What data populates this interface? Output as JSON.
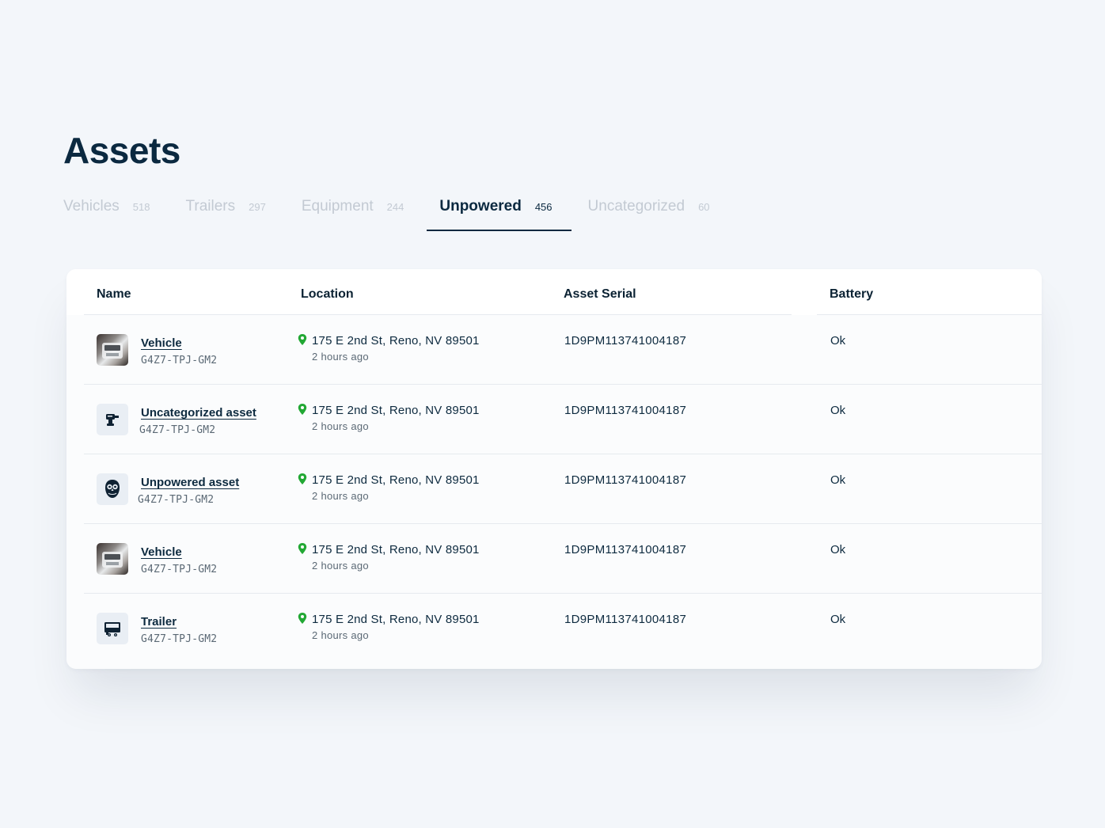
{
  "page": {
    "title": "Assets"
  },
  "tabs": [
    {
      "label": "Vehicles",
      "count": "518",
      "active": false
    },
    {
      "label": "Trailers",
      "count": "297",
      "active": false
    },
    {
      "label": "Equipment",
      "count": "244",
      "active": false
    },
    {
      "label": "Unpowered",
      "count": "456",
      "active": true
    },
    {
      "label": "Uncategorized",
      "count": "60",
      "active": false
    }
  ],
  "table": {
    "columns": [
      "Name",
      "Location",
      "Asset Serial",
      "Battery"
    ],
    "rows": [
      {
        "icon": "truck-photo",
        "name": "Vehicle",
        "id": "G4Z7-TPJ-GM2",
        "address": "175 E 2nd St, Reno, NV 89501",
        "updated": "2 hours ago",
        "serial": "1D9PM113741004187",
        "battery": "Ok"
      },
      {
        "icon": "drill-icon",
        "name": "Uncategorized asset",
        "id": "G4Z7-TPJ-GM2",
        "address": "175 E 2nd St, Reno, NV 89501",
        "updated": "2 hours ago",
        "serial": "1D9PM113741004187",
        "battery": "Ok"
      },
      {
        "icon": "owl-icon",
        "name": "Unpowered asset",
        "id": "G4Z7-TPJ-GM2",
        "address": "175 E 2nd St, Reno, NV 89501",
        "updated": "2 hours ago",
        "serial": "1D9PM113741004187",
        "battery": "Ok"
      },
      {
        "icon": "truck-photo",
        "name": "Vehicle",
        "id": "G4Z7-TPJ-GM2",
        "address": "175 E 2nd St, Reno, NV 89501",
        "updated": "2 hours ago",
        "serial": "1D9PM113741004187",
        "battery": "Ok"
      },
      {
        "icon": "trailer-icon",
        "name": "Trailer",
        "id": "G4Z7-TPJ-GM2",
        "address": "175 E 2nd St, Reno, NV 89501",
        "updated": "2 hours ago",
        "serial": "1D9PM113741004187",
        "battery": "Ok"
      }
    ]
  },
  "colors": {
    "title": "#0b2940",
    "pin": "#22a834",
    "tab_inactive": "#c3cad3",
    "background": "#f3f6fa"
  }
}
